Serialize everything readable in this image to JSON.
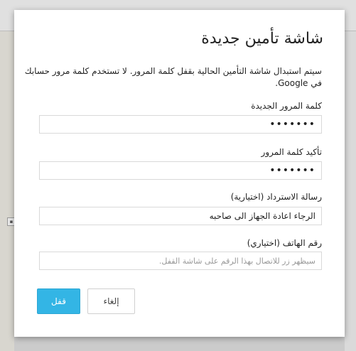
{
  "dialog": {
    "title": "شاشة تأمين جديدة",
    "description": "سيتم استبدال شاشة التأمين الحالية بقفل كلمة المرور. لا تستخدم كلمة مرور حسابك في Google.",
    "new_password": {
      "label": "كلمة المرور الجديدة",
      "value": "•••••••"
    },
    "confirm_password": {
      "label": "تأكيد كلمة المرور",
      "value": "•••••••"
    },
    "recovery_message": {
      "label": "رسالة الاسترداد (اختيارية)",
      "value": "الرجاء اعادة الجهاز الى صاحبه"
    },
    "phone_number": {
      "label": "رقم الهاتف (اختياري)",
      "placeholder": "سيظهر زر للاتصال بهذا الرقم على شاشة القفل."
    },
    "buttons": {
      "lock": "قفل",
      "cancel": "إلغاء"
    }
  },
  "colors": {
    "primary_button": "#33b5e5"
  }
}
